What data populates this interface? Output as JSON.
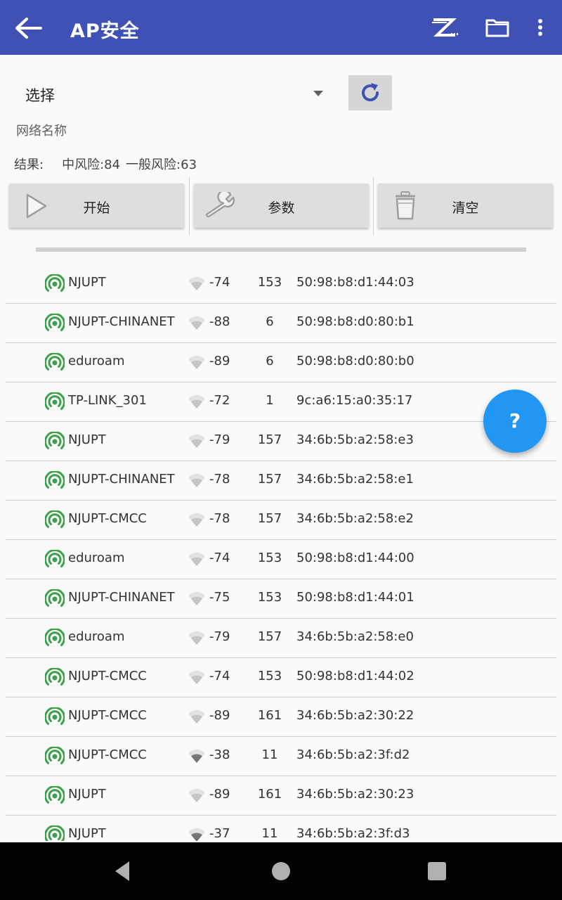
{
  "appbar": {
    "title": "AP安全"
  },
  "controls": {
    "select_text": "选择",
    "network_label": "网络名称",
    "result_label": "结果:",
    "medium_risk": "中风险:84",
    "general_risk": "一般风险:63"
  },
  "buttons": {
    "start": "开始",
    "params": "参数",
    "clear": "清空"
  },
  "fab": {
    "label": "?"
  },
  "colors": {
    "appbar": "#3f51b5",
    "fab": "#2196f3",
    "ap_icon": "#3aa04a",
    "refresh_icon": "#3f51b5"
  },
  "icons": {
    "back": "arrow-back-icon",
    "zapp": "z-logo-icon",
    "folder": "folder-icon",
    "more": "more-vert-icon",
    "refresh": "refresh-icon",
    "start": "play-icon",
    "params": "wrench-icon",
    "clear": "trash-icon",
    "row_ap": "access-point-icon",
    "row_signal": "wifi-signal-icon"
  },
  "aps": [
    {
      "ssid": "NJUPT",
      "rssi": "-74",
      "channel": "153",
      "mac": "50:98:b8:d1:44:03"
    },
    {
      "ssid": "NJUPT-CHINANET",
      "rssi": "-88",
      "channel": "6",
      "mac": "50:98:b8:d0:80:b1"
    },
    {
      "ssid": "eduroam",
      "rssi": "-89",
      "channel": "6",
      "mac": "50:98:b8:d0:80:b0"
    },
    {
      "ssid": "TP-LINK_301",
      "rssi": "-72",
      "channel": "1",
      "mac": "9c:a6:15:a0:35:17"
    },
    {
      "ssid": "NJUPT",
      "rssi": "-79",
      "channel": "157",
      "mac": "34:6b:5b:a2:58:e3"
    },
    {
      "ssid": "NJUPT-CHINANET",
      "rssi": "-78",
      "channel": "157",
      "mac": "34:6b:5b:a2:58:e1"
    },
    {
      "ssid": "NJUPT-CMCC",
      "rssi": "-78",
      "channel": "157",
      "mac": "34:6b:5b:a2:58:e2"
    },
    {
      "ssid": "eduroam",
      "rssi": "-74",
      "channel": "153",
      "mac": "50:98:b8:d1:44:00"
    },
    {
      "ssid": "NJUPT-CHINANET",
      "rssi": "-75",
      "channel": "153",
      "mac": "50:98:b8:d1:44:01"
    },
    {
      "ssid": "eduroam",
      "rssi": "-79",
      "channel": "157",
      "mac": "34:6b:5b:a2:58:e0"
    },
    {
      "ssid": "NJUPT-CMCC",
      "rssi": "-74",
      "channel": "153",
      "mac": "50:98:b8:d1:44:02"
    },
    {
      "ssid": "NJUPT-CMCC",
      "rssi": "-89",
      "channel": "161",
      "mac": "34:6b:5b:a2:30:22"
    },
    {
      "ssid": "NJUPT-CMCC",
      "rssi": "-38",
      "channel": "11",
      "mac": "34:6b:5b:a2:3f:d2"
    },
    {
      "ssid": "NJUPT",
      "rssi": "-89",
      "channel": "161",
      "mac": "34:6b:5b:a2:30:23"
    },
    {
      "ssid": "NJUPT",
      "rssi": "-37",
      "channel": "11",
      "mac": "34:6b:5b:a2:3f:d3"
    }
  ]
}
